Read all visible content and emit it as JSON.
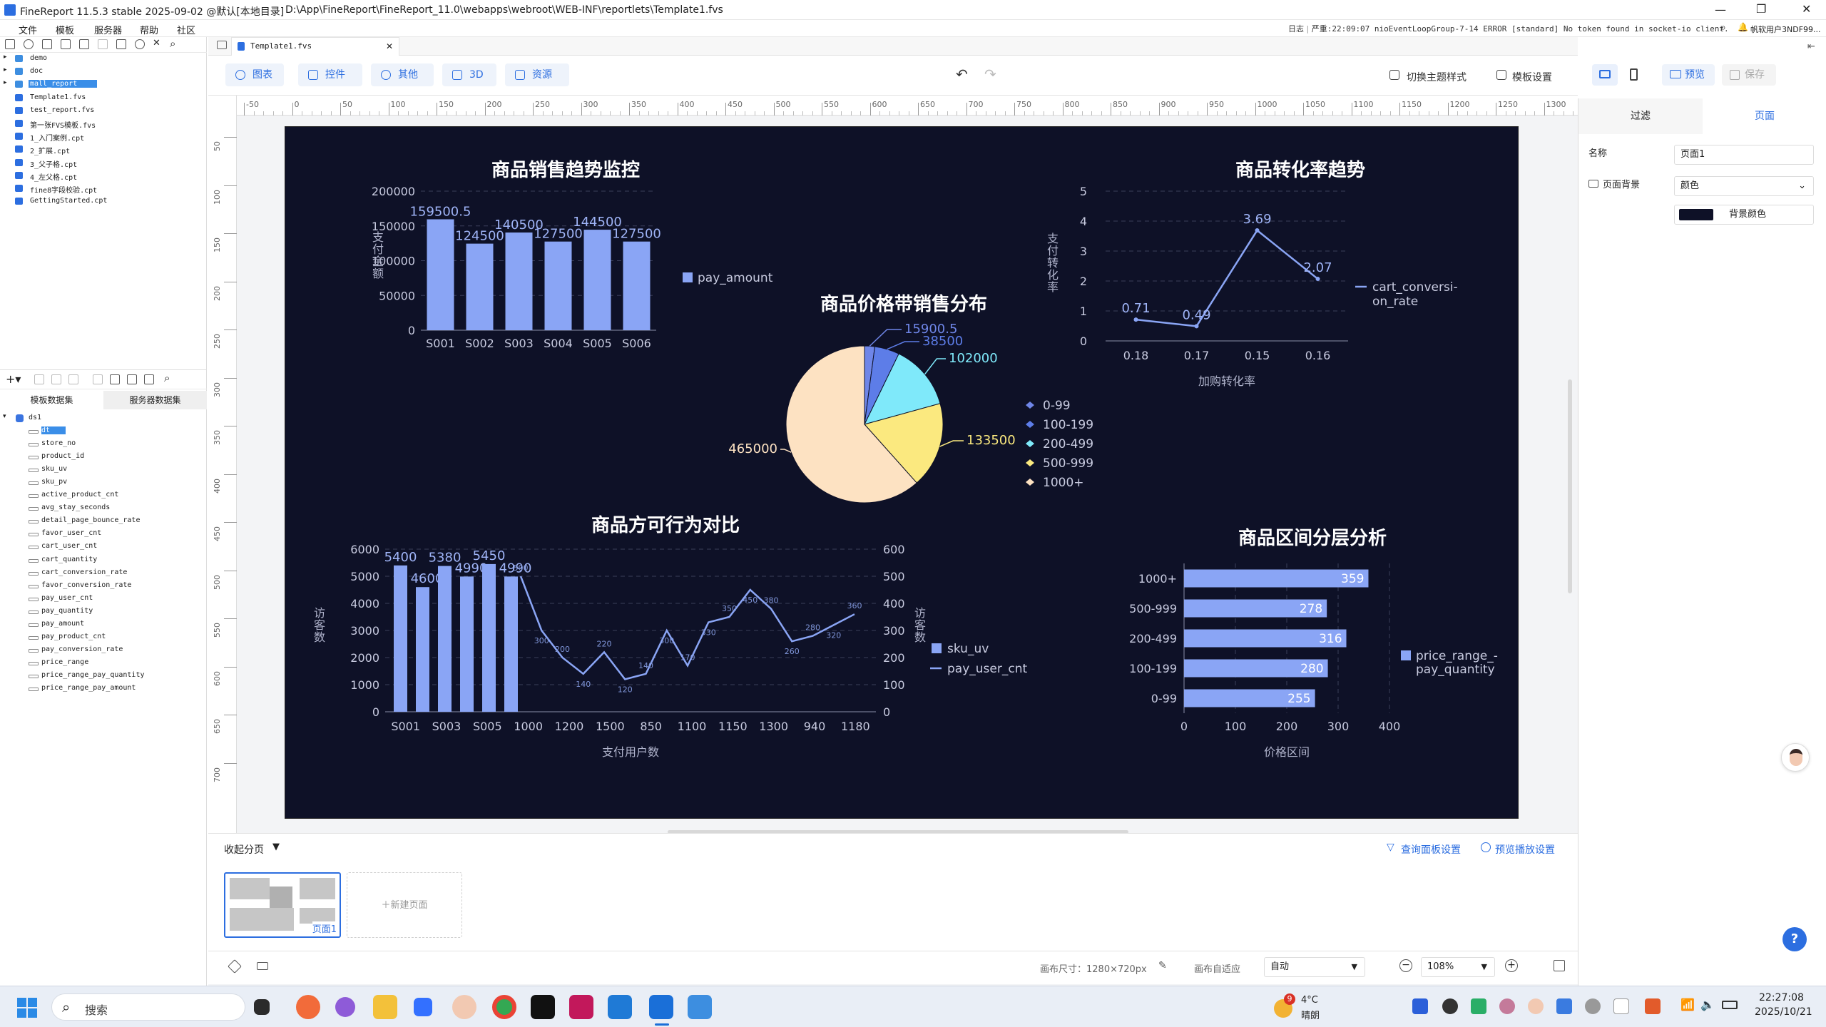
{
  "app": {
    "title": "FineReport 11.5.3 stable 2025-09-02 @默认[本地目录]",
    "path": "D:\\App\\FineReport\\FineReport_11.0\\webapps\\webroot\\WEB-INF\\reportlets\\Template1.fvs"
  },
  "menu": [
    "文件",
    "模板",
    "服务器",
    "帮助",
    "社区"
  ],
  "statusline": {
    "log_label": "日志",
    "severity": "严重",
    "message": ":22:09:07 nioEventLoopGroup-7-14 ERROR [standard] No token found in socket-io client.",
    "user": "帆软用户3NDF99..."
  },
  "tree": {
    "items": [
      {
        "label": "demo",
        "kind": "folder"
      },
      {
        "label": "doc",
        "kind": "folder"
      },
      {
        "label": "mall_report",
        "kind": "folder"
      },
      {
        "label": "Template1.fvs",
        "kind": "fvs"
      },
      {
        "label": "test_report.fvs",
        "kind": "fvs"
      },
      {
        "label": "第一张FVS模板.fvs",
        "kind": "fvs"
      },
      {
        "label": "1_入门案例.cpt",
        "kind": "cpt"
      },
      {
        "label": "2_扩展.cpt",
        "kind": "cpt"
      },
      {
        "label": "3_父子格.cpt",
        "kind": "cpt"
      },
      {
        "label": "4_左父格.cpt",
        "kind": "cpt"
      },
      {
        "label": "fine8字段校验.cpt",
        "kind": "cpt"
      },
      {
        "label": "GettingStarted.cpt",
        "kind": "cpt"
      }
    ]
  },
  "dataset_tabs": [
    "模板数据集",
    "服务器数据集"
  ],
  "dataset": {
    "name": "ds1",
    "fields": [
      "dt",
      "store_no",
      "product_id",
      "sku_uv",
      "sku_pv",
      "active_product_cnt",
      "avg_stay_seconds",
      "detail_page_bounce_rate",
      "favor_user_cnt",
      "cart_user_cnt",
      "cart_quantity",
      "cart_conversion_rate",
      "favor_conversion_rate",
      "pay_user_cnt",
      "pay_quantity",
      "pay_amount",
      "pay_product_cnt",
      "pay_conversion_rate",
      "price_range",
      "price_range_pay_quantity",
      "price_range_pay_amount"
    ]
  },
  "doc_tab": "Template1.fvs",
  "toolbar": {
    "chips": [
      "图表",
      "控件",
      "其他",
      "3D",
      "资源"
    ],
    "theme": "切换主题样式",
    "template_settings": "模板设置",
    "preview": "预览",
    "save": "保存"
  },
  "ruler_h": [
    "-50",
    "0",
    "50",
    "100",
    "150",
    "200",
    "250",
    "300",
    "350",
    "400",
    "450",
    "500",
    "550",
    "600",
    "650",
    "700",
    "750",
    "800",
    "850",
    "900",
    "950",
    "1000",
    "1050",
    "1100",
    "1150",
    "1200",
    "1250",
    "1300"
  ],
  "ruler_v": [
    "50",
    "100",
    "150",
    "200",
    "250",
    "300",
    "350",
    "400",
    "450",
    "500",
    "550",
    "600",
    "650",
    "700"
  ],
  "right": {
    "tabs": [
      "过滤",
      "页面"
    ],
    "name_label": "名称",
    "name_value": "页面1",
    "bg_label": "页面背景",
    "bg_type": "颜色",
    "bg_color_label": "背景颜色",
    "bg_color": "#0e1127"
  },
  "pages": {
    "collapse": "收起分页",
    "query_settings": "查询面板设置",
    "play_settings": "预览播放设置",
    "page1": "页面1",
    "new_page": "新建页面"
  },
  "bottom": {
    "canvas_size": "画布尺寸：1280×720px",
    "adapt_label": "画布自适应",
    "adapt_value": "自动",
    "zoom": "108%"
  },
  "taskbar": {
    "search": "搜索",
    "weather_temp": "4°C",
    "weather_desc": "晴朗",
    "weather_badge": "9",
    "time": "22:27:08",
    "date": "2025/10/21"
  },
  "chart_data": [
    {
      "type": "bar",
      "title": "商品销售趋势监控",
      "categories": [
        "S001",
        "S002",
        "S003",
        "S004",
        "S005",
        "S006"
      ],
      "series": [
        {
          "name": "pay_amount",
          "values": [
            159500.5,
            124500,
            140500,
            127500,
            144500,
            127500
          ]
        }
      ],
      "ylabel": "支付金额",
      "ylim": [
        0,
        200000
      ],
      "yticks": [
        0,
        50000,
        100000,
        150000,
        200000
      ],
      "color": "#8aa5f5"
    },
    {
      "type": "pie",
      "title": "商品价格带销售分布",
      "slices": [
        {
          "name": "0-99",
          "value": 15900.5,
          "color": "#6f86e8"
        },
        {
          "name": "100-199",
          "value": 38500,
          "color": "#5d7de8"
        },
        {
          "name": "200-499",
          "value": 102000,
          "color": "#7fe9fa"
        },
        {
          "name": "500-999",
          "value": 133500,
          "color": "#fbe97f"
        },
        {
          "name": "1000+",
          "value": 465000,
          "color": "#fde2c2"
        }
      ]
    },
    {
      "type": "line",
      "title": "商品转化率趋势",
      "categories": [
        "0.18",
        "0.17",
        "0.15",
        "0.16"
      ],
      "series": [
        {
          "name": "cart_conversion_rate",
          "values": [
            0.71,
            0.49,
            3.69,
            2.07
          ]
        }
      ],
      "legend": [
        "cart_conversi-",
        "on_rate"
      ],
      "xlabel": "加购转化率",
      "ylabel": "支付转化率",
      "ylim": [
        0,
        5
      ],
      "yticks": [
        0,
        1,
        2,
        3,
        4,
        5
      ],
      "color": "#8aa5f5"
    },
    {
      "type": "bar+line",
      "title": "商品方可行为对比",
      "categories": [
        "S001",
        "S002",
        "S003",
        "S004",
        "S005",
        "S006"
      ],
      "xticks": [
        "S001",
        "S003",
        "S005",
        "1000",
        "1200",
        "1500",
        "850",
        "1100",
        "1150",
        "1300",
        "940",
        "1180"
      ],
      "bars": {
        "name": "sku_uv",
        "values": [
          5400,
          4600,
          5380,
          4990,
          5450,
          4990
        ]
      },
      "line": {
        "name": "pay_user_cnt",
        "values": [
          500,
          300,
          200,
          140,
          220,
          120,
          140,
          300,
          170,
          330,
          350,
          450,
          380,
          260,
          280,
          320,
          360
        ]
      },
      "xlabel": "支付用户数",
      "ylabel": "访客数",
      "ylabel_right": "访客数",
      "ylim": [
        0,
        6000
      ],
      "yticks": [
        0,
        1000,
        2000,
        3000,
        4000,
        5000,
        6000
      ],
      "ylim_right": [
        0,
        600
      ],
      "yticks_right": [
        0,
        100,
        200,
        300,
        400,
        500,
        600
      ],
      "color": "#8aa5f5"
    },
    {
      "type": "hbar",
      "title": "商品区间分层分析",
      "categories": [
        "1000+",
        "500-999",
        "200-499",
        "100-199",
        "0-99"
      ],
      "series": [
        {
          "name": "price_range_pay_quantity",
          "values": [
            359,
            278,
            316,
            280,
            255
          ]
        }
      ],
      "legend": [
        "price_range_-",
        "pay_quantity"
      ],
      "xlabel": "价格区间",
      "xlim": [
        0,
        400
      ],
      "xticks": [
        0,
        100,
        200,
        300,
        400
      ],
      "color": "#8aa5f5"
    }
  ]
}
